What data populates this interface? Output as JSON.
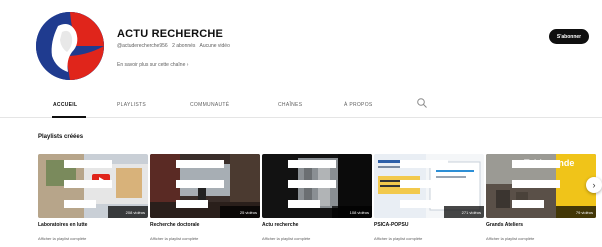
{
  "channel": {
    "name": "ACTU RECHERCHE",
    "handle": "@actuderecherche956",
    "subscribers": "2 abonnés",
    "videos": "Aucune vidéo",
    "more_link": "En savoir plus sur cette chaîne",
    "subscribe_label": "S'abonner"
  },
  "tabs": [
    {
      "label": "ACCUEIL",
      "active": true
    },
    {
      "label": "PLAYLISTS",
      "active": false
    },
    {
      "label": "COMMUNAUTÉ",
      "active": false
    },
    {
      "label": "CHAÎNES",
      "active": false
    },
    {
      "label": "À PROPOS",
      "active": false
    }
  ],
  "section": {
    "title": "Playlists créées"
  },
  "playlists": [
    {
      "title": "Laboratoires en lutte",
      "count": "208 vidéos",
      "link": "Afficher la playlist complète"
    },
    {
      "title": "Recherche doctorale",
      "count": "25 vidéos",
      "link": "Afficher la playlist complète"
    },
    {
      "title": "Actu recherche",
      "count": "108 vidéos",
      "link": "Afficher la playlist complète"
    },
    {
      "title": "PSICA-POPSU",
      "count": "271 vidéos",
      "link": "Afficher la playlist complète"
    },
    {
      "title": "Grands Ateliers",
      "count": "79 vidéos",
      "link": "Afficher la playlist complète"
    }
  ],
  "thumbnail_texts": {
    "grands_ateliers_overlay": "Table ronde"
  },
  "icons": {
    "search": "search-icon",
    "next": "chevron-right-icon",
    "playlist": "playlist-icon"
  },
  "colors": {
    "subscribe_bg": "#0f0f0f",
    "accent_red": "#e0251b",
    "accent_blue": "#1f3b8f",
    "tab_active": "#0f0f0f",
    "muted": "#606060"
  }
}
